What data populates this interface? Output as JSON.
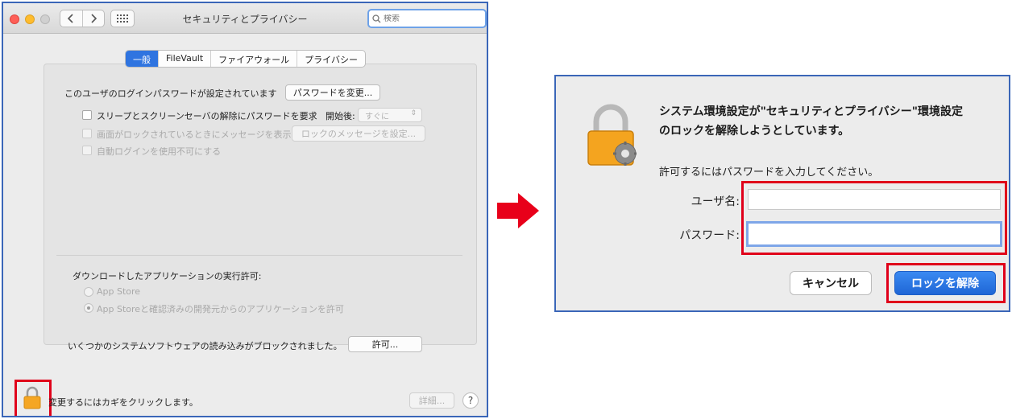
{
  "window": {
    "title": "セキュリティとプライバシー",
    "search_placeholder": "検索",
    "tabs": [
      {
        "label": "一般",
        "active": true
      },
      {
        "label": "FileVault",
        "active": false
      },
      {
        "label": "ファイアウォール",
        "active": false
      },
      {
        "label": "プライバシー",
        "active": false
      }
    ],
    "password_set_text": "このユーザのログインパスワードが設定されています",
    "change_password_label": "パスワードを変更...",
    "sleep_checkbox_label": "スリープとスクリーンセーバの解除にパスワードを要求",
    "start_after_label": "開始後:",
    "start_after_value": "すぐに",
    "lock_message_checkbox_label": "画面がロックされているときにメッセージを表示",
    "set_lock_message_label": "ロックのメッセージを設定...",
    "auto_login_checkbox_label": "自動ログインを使用不可にする",
    "download_heading": "ダウンロードしたアプリケーションの実行許可:",
    "radio_app_store": "App Store",
    "radio_app_store_dev": "App Storeと確認済みの開発元からのアプリケーションを許可",
    "blocked_text": "いくつかのシステムソフトウェアの読み込みがブロックされました。",
    "allow_label": "許可...",
    "lock_hint": "変更するにはカギをクリックします。",
    "details_label": "詳細...",
    "help_label": "?",
    "colors": {
      "accent": "#2f74e0",
      "highlight": "#e0001a",
      "window_border": "#3a66b8"
    }
  },
  "dialog": {
    "title_line1": "システム環境設定が\"セキュリティとプライバシー\"環境設定",
    "title_line2": "のロックを解除しようとしています。",
    "subtitle": "許可するにはパスワードを入力してください。",
    "username_label": "ユーザ名:",
    "username_value": "",
    "password_label": "パスワード:",
    "password_value": "",
    "cancel_label": "キャンセル",
    "unlock_label": "ロックを解除"
  },
  "arrow_icon": "right-arrow-icon"
}
